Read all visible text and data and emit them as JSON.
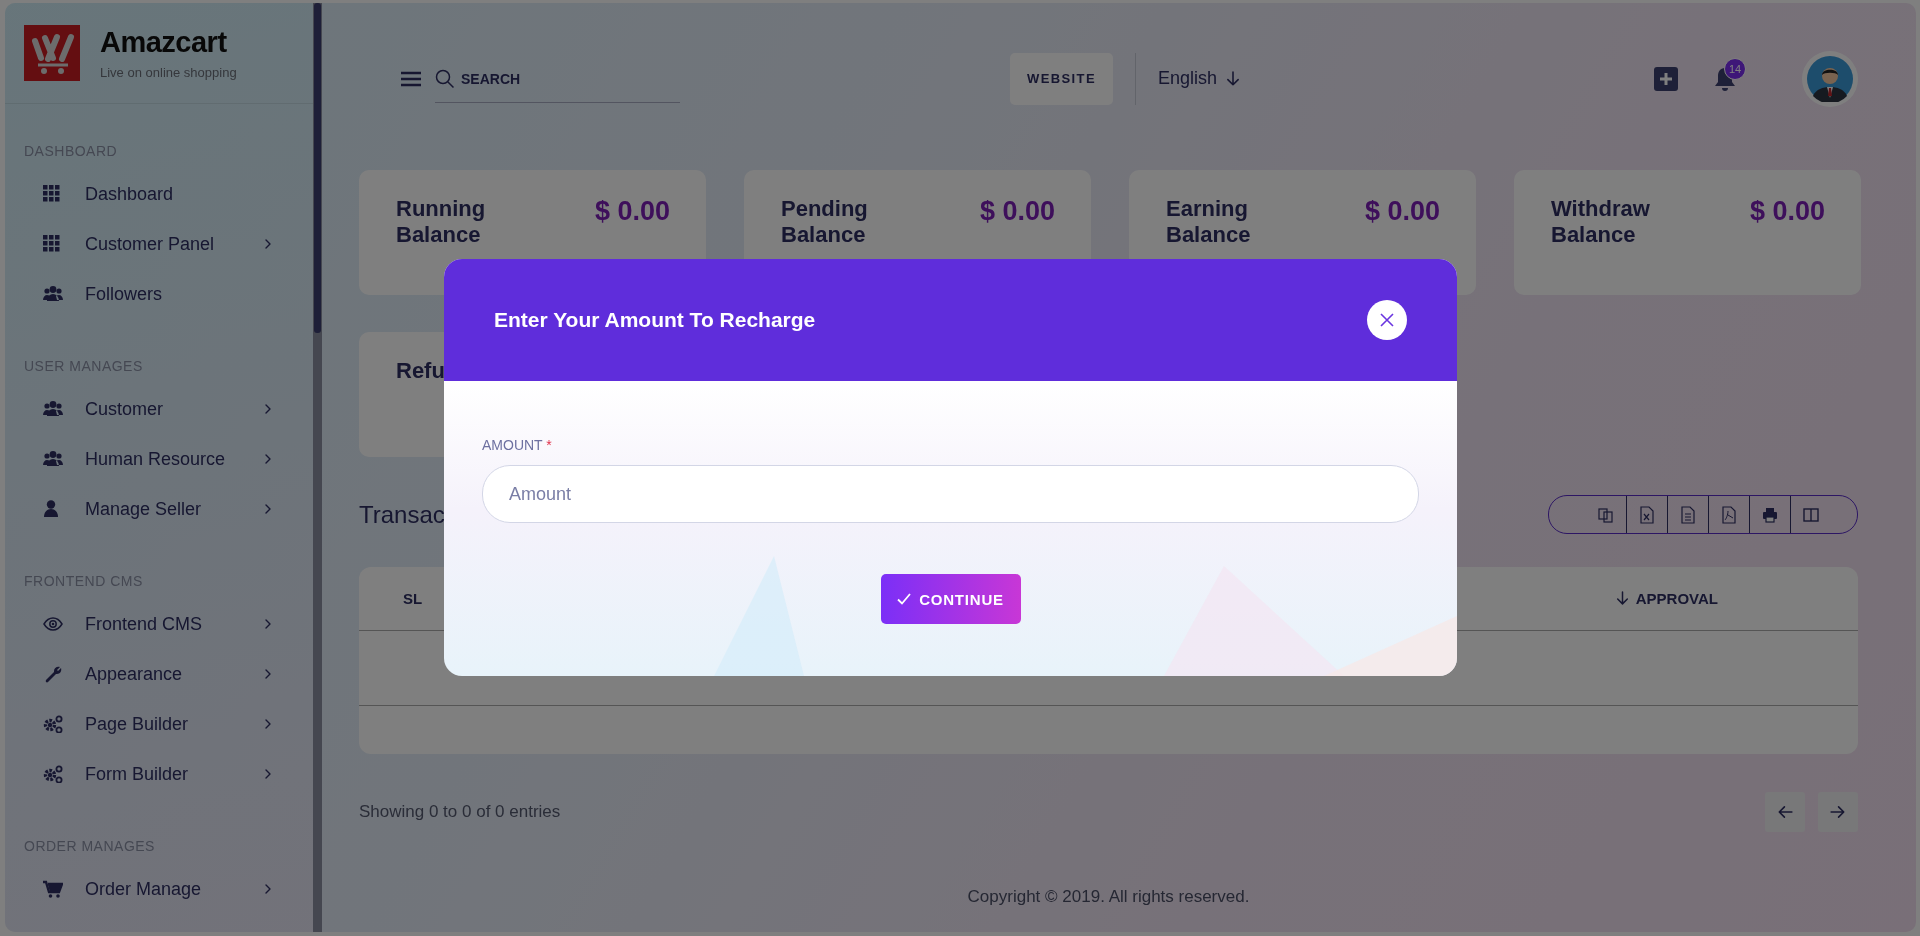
{
  "brand": {
    "name": "Amazcart",
    "tagline": "Live on online shopping"
  },
  "sidebar": {
    "sections": [
      {
        "title": "DASHBOARD",
        "items": [
          {
            "label": "Dashboard",
            "expandable": false
          },
          {
            "label": "Customer Panel",
            "expandable": true
          },
          {
            "label": "Followers",
            "expandable": false
          }
        ]
      },
      {
        "title": "USER MANAGES",
        "items": [
          {
            "label": "Customer",
            "expandable": true
          },
          {
            "label": "Human Resource",
            "expandable": true
          },
          {
            "label": "Manage Seller",
            "expandable": true
          }
        ]
      },
      {
        "title": "FRONTEND CMS",
        "items": [
          {
            "label": "Frontend CMS",
            "expandable": true
          },
          {
            "label": "Appearance",
            "expandable": true
          },
          {
            "label": "Page Builder",
            "expandable": true
          },
          {
            "label": "Form Builder",
            "expandable": true
          }
        ]
      },
      {
        "title": "ORDER MANAGES",
        "items": [
          {
            "label": "Order Manage",
            "expandable": true
          }
        ]
      }
    ]
  },
  "header": {
    "search": {
      "placeholder": "SEARCH"
    },
    "website_button": "WEBSITE",
    "language": "English",
    "notification_count": "14"
  },
  "cards": [
    {
      "label": "Running Balance",
      "value": "$ 0.00"
    },
    {
      "label": "Pending Balance",
      "value": "$ 0.00"
    },
    {
      "label": "Earning Balance",
      "value": "$ 0.00"
    },
    {
      "label": "Withdraw Balance",
      "value": "$ 0.00"
    },
    {
      "label": "Refu"
    }
  ],
  "transactions": {
    "title": "Transac",
    "columns": [
      "SL",
      "APPROVAL"
    ],
    "summary": "Showing 0 to 0 of 0 entries"
  },
  "footer": {
    "copyright": "Copyright © 2019. All rights reserved."
  },
  "modal": {
    "title": "Enter Your Amount To Recharge",
    "field": {
      "label": "AMOUNT",
      "required_mark": "*",
      "placeholder": "Amount"
    },
    "button": "CONTINUE"
  }
}
